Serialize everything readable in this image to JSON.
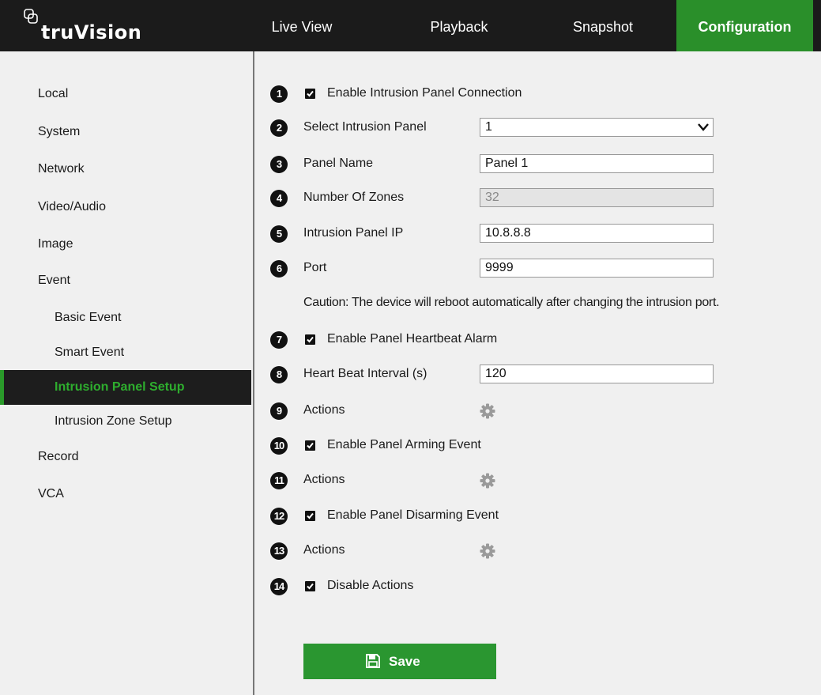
{
  "header": {
    "logo_text": "truVision",
    "tabs": [
      {
        "label": "Live View"
      },
      {
        "label": "Playback"
      },
      {
        "label": "Snapshot"
      },
      {
        "label": "Configuration"
      }
    ],
    "active_tab": "Configuration",
    "accent_color": "#2a8f2a"
  },
  "sidebar": {
    "items": [
      {
        "label": "Local"
      },
      {
        "label": "System"
      },
      {
        "label": "Network"
      },
      {
        "label": "Video/Audio"
      },
      {
        "label": "Image"
      },
      {
        "label": "Event"
      },
      {
        "label": "Basic Event"
      },
      {
        "label": "Smart Event"
      },
      {
        "label": "Intrusion Panel Setup"
      },
      {
        "label": "Intrusion Zone Setup"
      },
      {
        "label": "Record"
      },
      {
        "label": "VCA"
      }
    ],
    "active_item": "Intrusion Panel Setup"
  },
  "form": {
    "rows": [
      {
        "num": "1",
        "label": "Enable Intrusion Panel Connection",
        "checked": true
      },
      {
        "num": "2",
        "label": "Select Intrusion Panel",
        "value": "1"
      },
      {
        "num": "3",
        "label": "Panel Name",
        "value": "Panel 1"
      },
      {
        "num": "4",
        "label": "Number Of Zones",
        "value": "32"
      },
      {
        "num": "5",
        "label": "Intrusion Panel IP",
        "value": "10.8.8.8"
      },
      {
        "num": "6",
        "label": "Port",
        "value": "9999"
      },
      {
        "num": "7",
        "label": "Enable Panel Heartbeat Alarm",
        "checked": true
      },
      {
        "num": "8",
        "label": "Heart Beat Interval (s)",
        "value": "120"
      },
      {
        "num": "9",
        "label": "Actions",
        "icon": "gear-icon"
      },
      {
        "num": "10",
        "label": "Enable Panel Arming Event",
        "checked": true
      },
      {
        "num": "11",
        "label": "Actions",
        "icon": "gear-icon"
      },
      {
        "num": "12",
        "label": "Enable Panel Disarming Event",
        "checked": true
      },
      {
        "num": "13",
        "label": "Actions",
        "icon": "gear-icon"
      },
      {
        "num": "14",
        "label": "Disable Actions",
        "checked": true
      }
    ],
    "caution": "Caution: The device will reboot automatically after changing the intrusion port.",
    "save_label": "Save"
  }
}
